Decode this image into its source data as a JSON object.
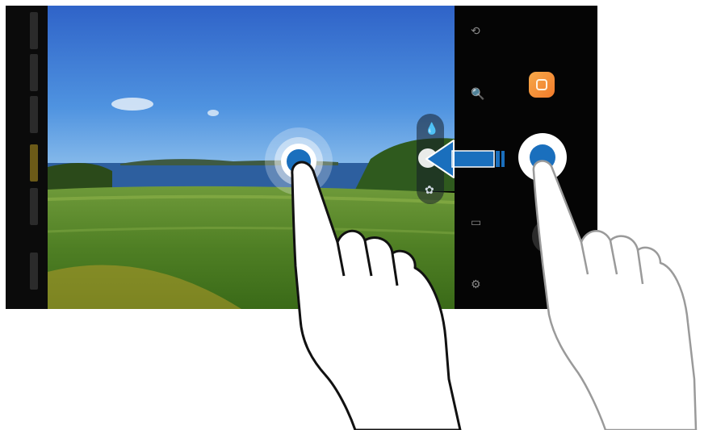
{
  "screen": {
    "description_free": true,
    "colors": {
      "accent_blue": "#1a6fbd",
      "record_red": "#d8202a",
      "bixby_orange": "#f27a2a"
    }
  },
  "left_modes": [
    {
      "icon": "mode-item",
      "active": false
    },
    {
      "icon": "mode-item",
      "active": false
    },
    {
      "icon": "mode-item",
      "active": false
    },
    {
      "icon": "mode-item",
      "active": true
    },
    {
      "icon": "mode-item",
      "active": false
    },
    {
      "icon": "mode-item",
      "active": false
    }
  ],
  "filters": {
    "icons": [
      "water-drop-icon",
      "adjust-icon",
      "flower-icon"
    ]
  },
  "right_controls": {
    "icons": [
      "switch-camera-icon",
      "zoom-icon",
      "bixby-vision-icon",
      "shutter-button",
      "gallery-icon",
      "record-button",
      "settings-icon"
    ]
  },
  "gesture": {
    "direction": "left",
    "hands": 2
  }
}
